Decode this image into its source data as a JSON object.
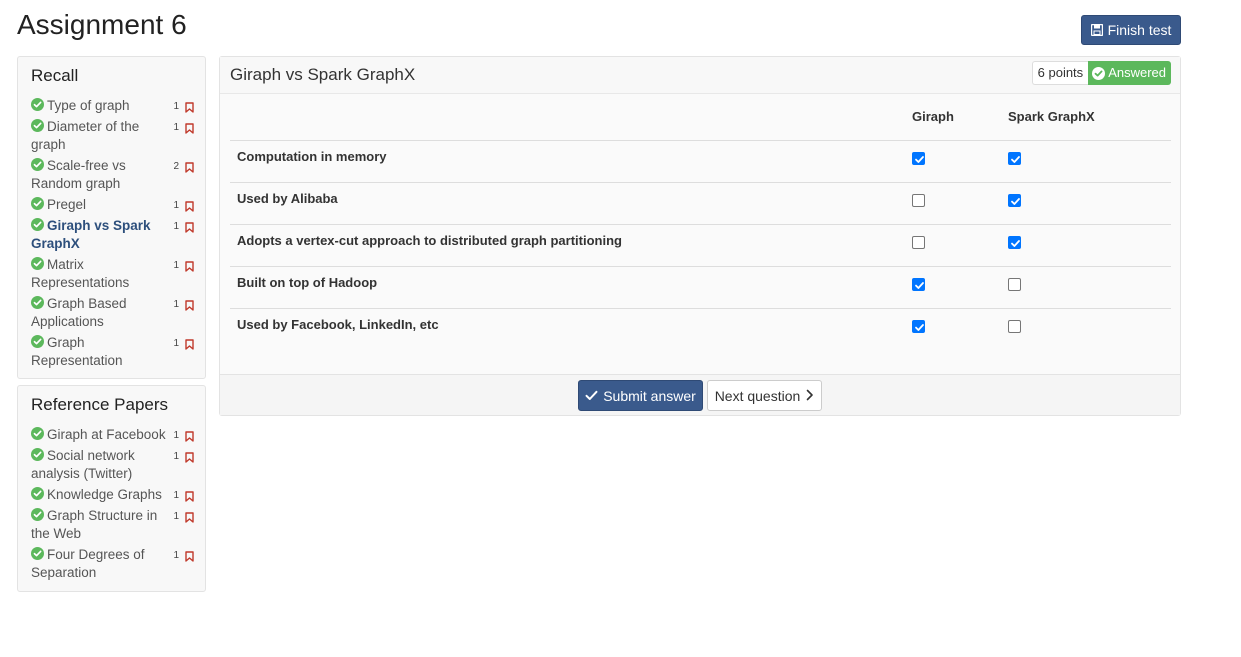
{
  "page": {
    "title": "Assignment 6"
  },
  "toolbar": {
    "finish_label": "Finish test"
  },
  "sections": [
    {
      "title": "Recall",
      "items": [
        {
          "label": "Type of graph",
          "points": "1",
          "active": false
        },
        {
          "label": "Diameter of the graph",
          "points": "1",
          "active": false
        },
        {
          "label": "Scale-free vs Random graph",
          "points": "2",
          "active": false
        },
        {
          "label": "Pregel",
          "points": "1",
          "active": false
        },
        {
          "label": "Giraph vs Spark GraphX",
          "points": "1",
          "active": true
        },
        {
          "label": "Matrix Representations",
          "points": "1",
          "active": false
        },
        {
          "label": "Graph Based Applications",
          "points": "1",
          "active": false
        },
        {
          "label": "Graph Representation",
          "points": "1",
          "active": false
        }
      ]
    },
    {
      "title": "Reference Papers",
      "items": [
        {
          "label": "Giraph at Facebook",
          "points": "1",
          "active": false
        },
        {
          "label": "Social network analysis (Twitter)",
          "points": "1",
          "active": false
        },
        {
          "label": "Knowledge Graphs",
          "points": "1",
          "active": false
        },
        {
          "label": "Graph Structure in the Web",
          "points": "1",
          "active": false
        },
        {
          "label": "Four Degrees of Separation",
          "points": "1",
          "active": false
        }
      ]
    }
  ],
  "question": {
    "title": "Giraph vs Spark GraphX",
    "points_label": "6 points",
    "status_label": "Answered",
    "columns": [
      "Giraph",
      "Spark GraphX"
    ],
    "rows": [
      {
        "label": "Computation in memory",
        "checks": [
          true,
          true
        ]
      },
      {
        "label": "Used by Alibaba",
        "checks": [
          false,
          true
        ]
      },
      {
        "label": "Adopts a vertex-cut approach to distributed graph partitioning",
        "checks": [
          false,
          true
        ]
      },
      {
        "label": "Built on top of Hadoop",
        "checks": [
          true,
          false
        ]
      },
      {
        "label": "Used by Facebook, LinkedIn, etc",
        "checks": [
          true,
          false
        ]
      }
    ],
    "submit_label": "Submit answer",
    "next_label": "Next question"
  },
  "colors": {
    "primary": "#3a5a8c",
    "success": "#5cb85c",
    "checkbox": "#0075ff",
    "bookmark": "#c0392b",
    "active_link": "#2d4f7c"
  },
  "icons": {
    "finish": "floppy-disk-icon",
    "done": "check-circle-icon",
    "bookmark": "bookmark-icon",
    "submit": "checkmark-icon",
    "next": "chevron-right-icon"
  }
}
